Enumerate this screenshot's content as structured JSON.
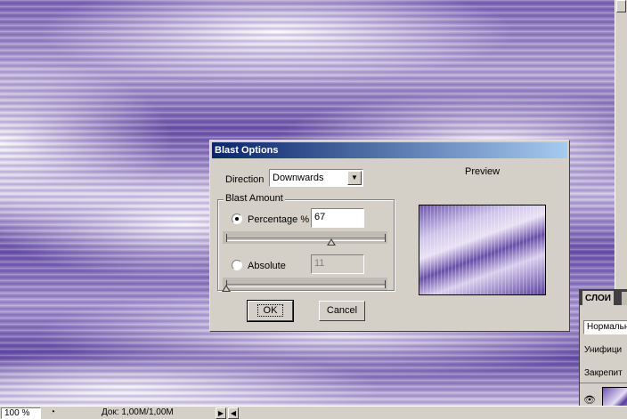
{
  "dialog": {
    "title": "Blast Options",
    "direction_label": "Direction",
    "direction_value": "Downwards",
    "group_title": "Blast Amount",
    "percentage_label": "Percentage %",
    "percentage_value": "67",
    "percentage_selected": true,
    "absolute_label": "Absolute",
    "absolute_value": "11",
    "absolute_selected": false,
    "ok_label": "OK",
    "cancel_label": "Cancel",
    "preview_label": "Preview"
  },
  "statusbar": {
    "zoom": "100 %",
    "doc_info": "Док: 1,00M/1,00M"
  },
  "layers_panel": {
    "tab_label": "СЛОИ",
    "blend_mode": "Нормальн",
    "unify_label": "Унифици",
    "lock_label": "Закрепит"
  },
  "colors": {
    "titlebar_start": "#0a246a",
    "titlebar_end": "#a6caf0",
    "dialog_bg": "#d4d0c8",
    "canvas_accent": "#6a50a8"
  }
}
